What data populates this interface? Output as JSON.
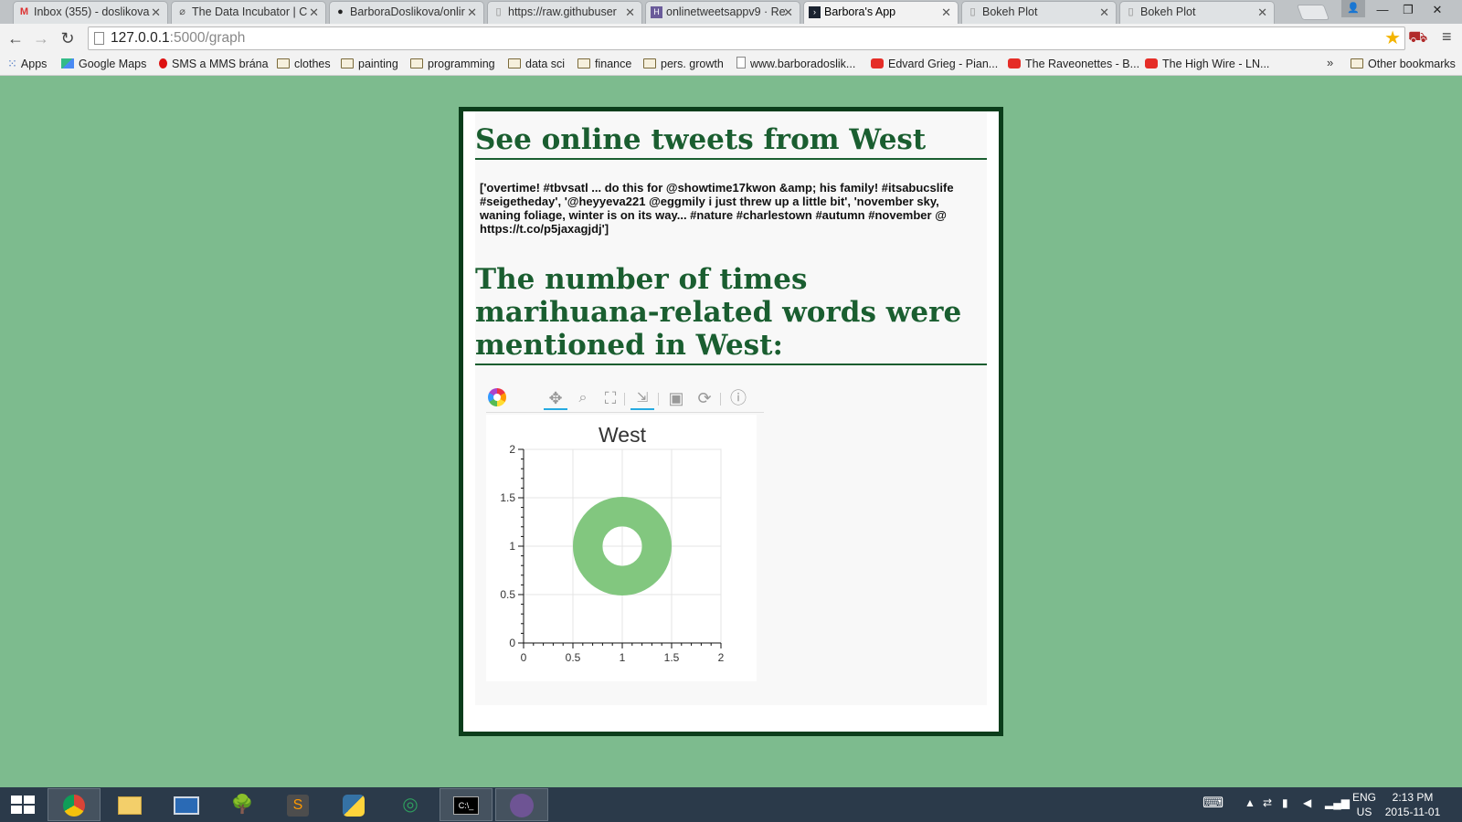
{
  "browser": {
    "tabs": [
      {
        "title": "Inbox (355) - doslikova",
        "icon": "gmail-icon",
        "active": false
      },
      {
        "title": "The Data Incubator | C",
        "icon": "incubator-icon",
        "active": false
      },
      {
        "title": "BarboraDoslikova/onlir",
        "icon": "github-icon",
        "active": false
      },
      {
        "title": "https://raw.githubuser",
        "icon": "page-icon",
        "active": false
      },
      {
        "title": "onlinetweetsappv9 · Re",
        "icon": "heroku-icon",
        "active": false
      },
      {
        "title": "Barbora's App",
        "icon": "terminal-icon",
        "active": true
      },
      {
        "title": "Bokeh Plot",
        "icon": "page-icon",
        "active": false
      },
      {
        "title": "Bokeh Plot",
        "icon": "page-icon",
        "active": false
      }
    ],
    "url_host": "127.0.0.1",
    "url_path": ":5000/graph",
    "bookmarks": [
      {
        "label": "Apps",
        "icon": "apps-grid-icon"
      },
      {
        "label": "Google Maps",
        "icon": "maps-icon"
      },
      {
        "label": "SMS a MMS brána",
        "icon": "vodafone-icon"
      },
      {
        "label": "clothes",
        "icon": "folder-icon"
      },
      {
        "label": "painting",
        "icon": "folder-icon"
      },
      {
        "label": "programming",
        "icon": "folder-icon"
      },
      {
        "label": "data sci",
        "icon": "folder-icon"
      },
      {
        "label": "finance",
        "icon": "folder-icon"
      },
      {
        "label": "pers. growth",
        "icon": "folder-icon"
      },
      {
        "label": "www.barboradoslik...",
        "icon": "page-icon"
      },
      {
        "label": "Edvard Grieg - Pian...",
        "icon": "youtube-icon"
      },
      {
        "label": "The Raveonettes - B...",
        "icon": "youtube-icon"
      },
      {
        "label": "The High Wire - LN...",
        "icon": "youtube-icon"
      }
    ],
    "bookmarks_more": "»",
    "other_bookmarks": "Other bookmarks"
  },
  "page": {
    "heading1": "See online tweets from West",
    "tweets": "['overtime! #tbvsatl ... do this for @showtime17kwon &amp; his family! #itsabucslife #seigetheday', '@heyyeva221 @eggmily i just threw up a little bit', 'november sky, waning foliage, winter is on its way... #nature #charlestown #autumn #november @ https://t.co/p5jaxagjdj']",
    "heading2": "The number of times marihuana-related words were mentioned in West:"
  },
  "chart_data": {
    "type": "scatter",
    "title": "West",
    "xlabel": "",
    "ylabel": "",
    "xlim": [
      0,
      2
    ],
    "ylim": [
      0,
      2
    ],
    "xticks": [
      "0",
      "0.5",
      "1",
      "1.5",
      "2"
    ],
    "yticks": [
      "0",
      "0.5",
      "1",
      "1.5",
      "2"
    ],
    "grid": true,
    "glyph": "annular_wedge",
    "points": [
      {
        "x": 1,
        "y": 1,
        "inner_radius": 0.2,
        "outer_radius": 0.5,
        "color": "#82c77f"
      }
    ]
  },
  "taskbar": {
    "lang": "ENG",
    "region": "US",
    "time": "2:13 PM",
    "date": "2015-11-01"
  },
  "colors": {
    "page_bg": "#7dbb8e",
    "heading": "#1a5e30",
    "card_border": "#0b3d1b"
  }
}
